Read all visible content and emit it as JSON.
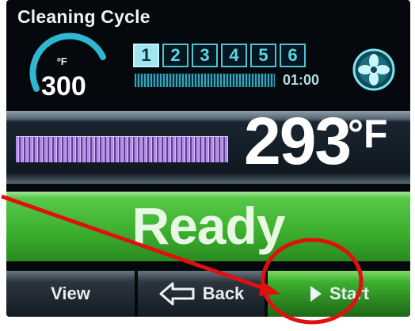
{
  "screen": {
    "title": "Cleaning Cycle"
  },
  "setpoint": {
    "unit": "ºF",
    "value": "300"
  },
  "cycle": {
    "steps": [
      "1",
      "2",
      "3",
      "4",
      "5",
      "6"
    ],
    "active_step": "1",
    "progress": 1.0,
    "timer": "01:00"
  },
  "temperature": {
    "value": "293",
    "unit": "°F",
    "bar_level": 0.55
  },
  "status": {
    "text": "Ready"
  },
  "softkeys": {
    "view": "View",
    "back": "Back",
    "start": "Start"
  },
  "icons": {
    "fan": "fan-icon",
    "back": "back-arrow-icon",
    "start": "play-icon"
  },
  "colors": {
    "accent_cyan": "#48c6d6",
    "ready_green": "#3cb02e",
    "temp_bar_purple": "#b58bea",
    "annotation_red": "#e01010"
  }
}
